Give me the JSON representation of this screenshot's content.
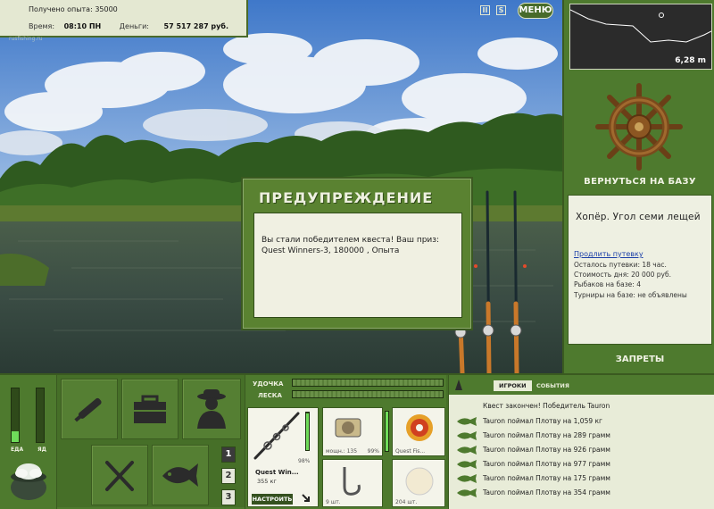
{
  "info": {
    "experience_label": "Получено опыта: 35000",
    "time_label": "Время:",
    "time_value": "08:10 ПН",
    "money_label": "Деньги:",
    "money_value": "57 517 287 руб."
  },
  "watermark": "rusfishing.ru",
  "top_bar": {
    "pause_glyph": "II",
    "sound_glyph": "S",
    "menu_label": "МЕНЮ"
  },
  "depth": {
    "value": "6,28 m"
  },
  "base": {
    "back_label": "ВЕРНУТЬСЯ НА БАЗУ",
    "spot_title": "Хопёр. Угол семи лещей",
    "extend_link": "Продлить путевку",
    "lines": [
      "Осталось путевки: 18 час.",
      "Стоимость дня: 20 000 руб.",
      "Рыбаков на базе: 4",
      "Турниры на базе: не объявлены"
    ],
    "bans_label": "ЗАПРЕТЫ"
  },
  "dialog": {
    "title": "ПРЕДУПРЕЖДЕНИЕ",
    "message": "Вы стали победителем квеста! Ваш приз: Quest Winners-3, 180000 , Опыта"
  },
  "meters": {
    "food_label": "ЕДА",
    "poison_label": "ЯД",
    "food_level": 0.2,
    "poison_level": 0.0
  },
  "actions": [
    "rod-bag",
    "tackle-box",
    "fisherman",
    "cutlery",
    "fish"
  ],
  "pages": [
    "1",
    "2",
    "3"
  ],
  "tackle": {
    "rod_label": "УДОЧКА",
    "line_label": "ЛЕСКА",
    "rod_name": "Quest Win...",
    "rod_weight": "355 кг",
    "rod_percent": "98%",
    "setup_label": "НАСТРОИТЬ",
    "reel_caption": "мощн.: 135",
    "reel_percent": "99%",
    "line_caption": "Quest Fis...",
    "hook_caption": "9 шт.",
    "bait_caption": "204 шт."
  },
  "events": {
    "tab_players": "ИГРОКИ",
    "tab_events": "СОБЫТИЯ",
    "quest_line": "Квест закончен! Победитель Tauron",
    "rows": [
      "Tauron поймал Плотву на 1,059 кг",
      "Tauron поймал Плотву на 289 грамм",
      "Tauron поймал Плотву на 926 грамм",
      "Tauron поймал Плотву на 977 грамм",
      "Tauron поймал Плотву на 175 грамм",
      "Tauron поймал Плотву на 354 грамм"
    ]
  }
}
